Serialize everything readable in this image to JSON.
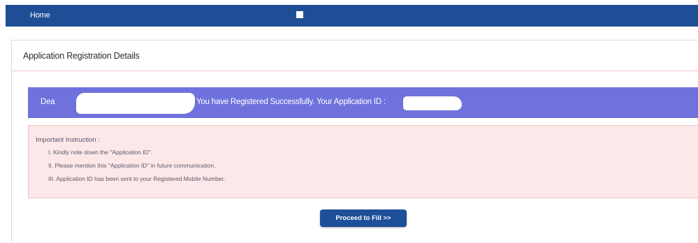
{
  "navbar": {
    "home_label": "Home"
  },
  "panel": {
    "title": "Application Registration Details"
  },
  "success": {
    "prefix": "Dea",
    "message": "You have Registered Successfully. Your Application ID :"
  },
  "instructions": {
    "heading": "Important Instruction :",
    "items": [
      "I. Kindly note down the \"Application ID\".",
      "II. Please mention this \"Application ID\" in future communication.",
      "III. Application ID has been sent to your Registered Mobile Number."
    ]
  },
  "actions": {
    "proceed_label": "Proceed to Fill >>"
  },
  "colors": {
    "navbar": "#1f4e96",
    "success_bar": "#6f72dc",
    "instruction_bg": "#fce8e9",
    "button": "#1e4f99"
  }
}
